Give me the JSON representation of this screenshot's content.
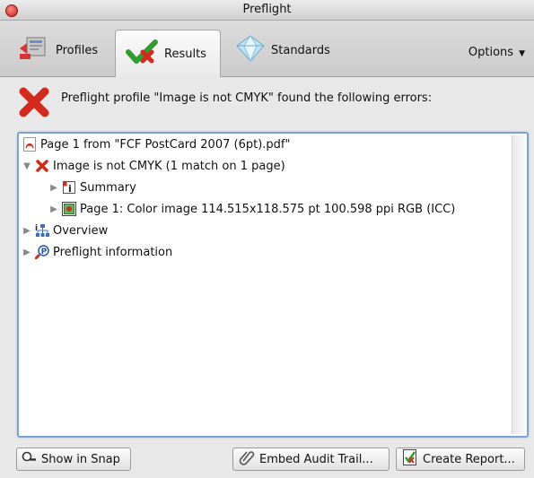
{
  "window": {
    "title": "Preflight"
  },
  "tabs": [
    {
      "label": "Profiles",
      "icon": "profiles-icon"
    },
    {
      "label": "Results",
      "icon": "results-checkmark-icon"
    },
    {
      "label": "Standards",
      "icon": "standards-diamond-icon"
    }
  ],
  "options_label": "Options",
  "banner": {
    "message": "Preflight profile \"Image is not CMYK\" found the following errors:",
    "icon": "error-x-icon"
  },
  "tree": [
    {
      "label": "Page 1 from \"FCF PostCard 2007 (6pt).pdf\"",
      "icon": "pdf-file-icon"
    },
    {
      "label": "Image is not CMYK (1 match on 1 page)",
      "icon": "error-x-icon",
      "expanded": true
    },
    {
      "label": "Summary",
      "icon": "info-icon"
    },
    {
      "label": "Page 1: Color image 114.515x118.575 pt 100.598 ppi RGB (ICC)",
      "icon": "image-icon"
    },
    {
      "label": "Overview",
      "icon": "hierarchy-icon"
    },
    {
      "label": "Preflight information",
      "icon": "magnifier-p-icon"
    }
  ],
  "buttons": {
    "show_in_snap": "Show in Snap",
    "embed_audit_trail": "Embed Audit Trail...",
    "create_report": "Create Report..."
  },
  "colors": {
    "accent_border": "#7aa3d8",
    "error_red": "#d42a1e",
    "check_green": "#2f9e2f"
  }
}
